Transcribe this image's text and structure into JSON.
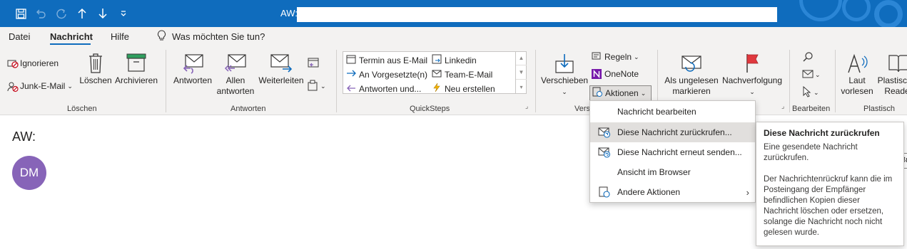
{
  "titlebar": {
    "title": "AW:",
    "icons": [
      "save-icon",
      "undo-icon",
      "redo-icon",
      "up-arrow-icon",
      "down-arrow-icon",
      "customize-icon"
    ]
  },
  "tabs": [
    {
      "label": "Datei"
    },
    {
      "label": "Nachricht",
      "active": true
    },
    {
      "label": "Hilfe"
    }
  ],
  "search": {
    "placeholder": "Was möchten Sie tun?"
  },
  "ribbon": {
    "loeschen": {
      "label": "Löschen",
      "ignorieren": "Ignorieren",
      "junk": "Junk-E-Mail",
      "loeschen_btn": "Löschen",
      "archivieren": "Archivieren"
    },
    "antworten": {
      "label": "Antworten",
      "antworten": "Antworten",
      "allen_1": "Allen",
      "allen_2": "antworten",
      "weiterleiten": "Weiterleiten"
    },
    "quicksteps": {
      "label": "QuickSteps",
      "items": [
        "Termin aus E-Mail",
        "An Vorgesetzte(n)",
        "Antworten und...",
        "Linkedin",
        "Team-E-Mail",
        "Neu erstellen"
      ]
    },
    "verschieben": {
      "label": "Vers",
      "verschieben": "Verschieben",
      "regeln": "Regeln",
      "onenote": "OneNote",
      "aktionen": "Aktionen"
    },
    "markieren": {
      "ungelesen_1": "Als ungelesen",
      "ungelesen_2": "markieren",
      "nachverfolgung": "Nachverfolgung"
    },
    "bearbeiten": {
      "label": "Bearbeiten"
    },
    "plastisch": {
      "label": "Plastisch",
      "laut_1": "Laut",
      "laut_2": "vorlesen",
      "reader_1": "Plastischer",
      "reader_2": "Reader"
    }
  },
  "message": {
    "subject": "AW:",
    "avatar_initials": "DM",
    "avatar_color": "#8764b8",
    "edge_button": "Br"
  },
  "menu": {
    "items": [
      {
        "label": "Nachricht bearbeiten",
        "icon": ""
      },
      {
        "label": "Diese Nachricht zurückrufen...",
        "icon": "recall-icon",
        "hover": true
      },
      {
        "label": "Diese Nachricht erneut senden...",
        "icon": "resend-icon"
      },
      {
        "label": "Ansicht im Browser",
        "icon": ""
      },
      {
        "label": "Andere Aktionen",
        "icon": "other-actions-icon",
        "submenu": true
      }
    ]
  },
  "tooltip": {
    "title": "Diese Nachricht zurückrufen",
    "para1": "Eine gesendete Nachricht zurückrufen.",
    "para2": "Der Nachrichtenrückruf kann die im Posteingang der Empfänger befindlichen Kopien dieser Nachricht löschen oder ersetzen, solange die Nachricht noch nicht gelesen wurde."
  },
  "colors": {
    "accent": "#0f6cbd",
    "ribbon_bg": "#f3f2f1",
    "hover": "#e1dfdd"
  }
}
